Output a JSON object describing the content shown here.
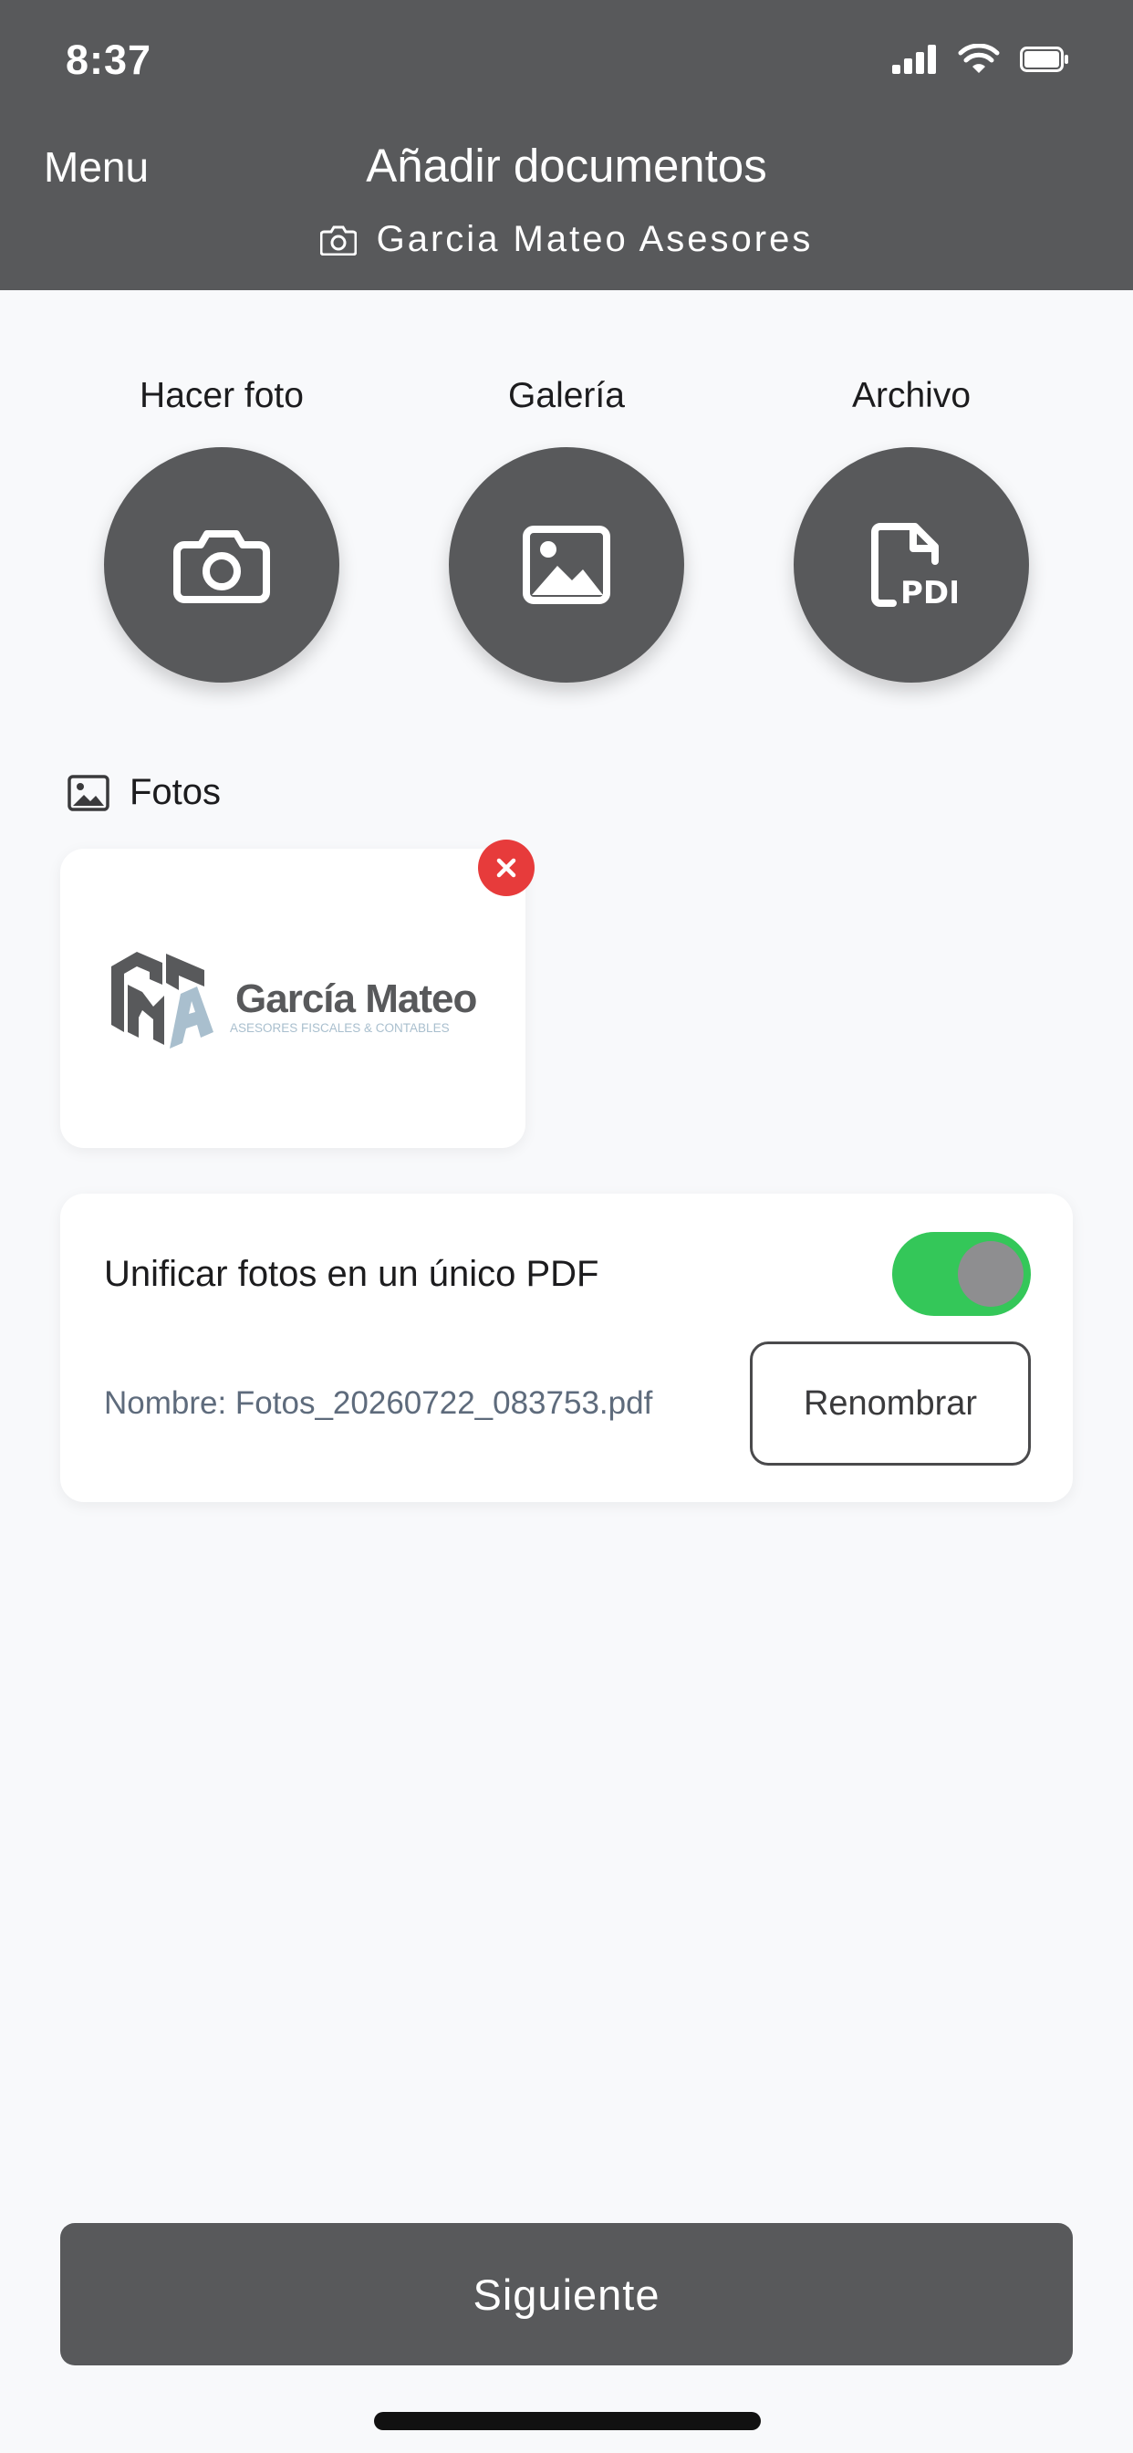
{
  "status_bar": {
    "time": "8:37"
  },
  "header": {
    "menu_label": "Menu",
    "title": "Añadir documentos",
    "subtitle": "Garcia Mateo Asesores"
  },
  "actions": [
    {
      "label": "Hacer foto",
      "icon": "camera-icon"
    },
    {
      "label": "Galería",
      "icon": "image-icon"
    },
    {
      "label": "Archivo",
      "icon": "pdf-file-icon"
    }
  ],
  "photos": {
    "section_label": "Fotos",
    "items": [
      {
        "logo_brand": "García Mateo",
        "logo_tagline": "ASESORES FISCALES & CONTABLES"
      }
    ]
  },
  "unify": {
    "label": "Unificar fotos en un único PDF",
    "enabled": true,
    "file_name": "Nombre: Fotos_20260722_083753.pdf",
    "rename_label": "Renombrar"
  },
  "footer": {
    "next_label": "Siguiente"
  },
  "colors": {
    "header_bg": "#58595b",
    "toggle_on": "#34c759",
    "remove": "#e73b3b",
    "page_bg": "#f8f9fb"
  }
}
